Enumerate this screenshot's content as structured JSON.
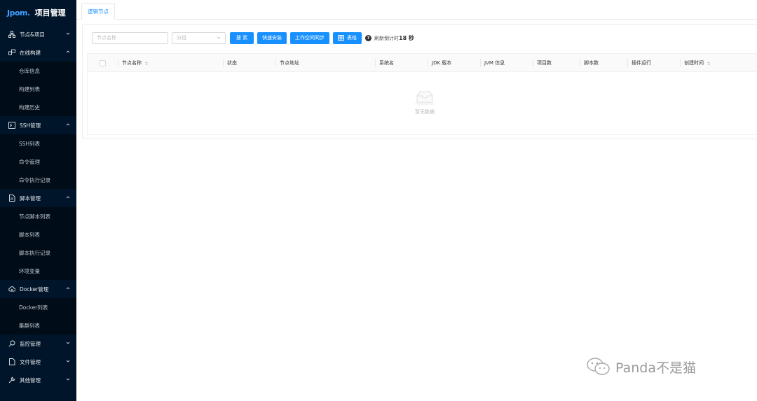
{
  "app": {
    "logo": "Jpom.",
    "title": "项目管理"
  },
  "sidebar": {
    "groups": [
      {
        "label": "节点&项目",
        "icon": "cluster-icon",
        "open": false,
        "items": []
      },
      {
        "label": "在线构建",
        "icon": "build-icon",
        "open": true,
        "items": [
          "仓库信息",
          "构建列表",
          "构建历史"
        ]
      },
      {
        "label": "SSH管理",
        "icon": "terminal-icon",
        "open": true,
        "items": [
          "SSH列表",
          "命令管理",
          "命令执行记录"
        ]
      },
      {
        "label": "脚本管理",
        "icon": "file-code-icon",
        "open": true,
        "items": [
          "节点脚本列表",
          "脚本列表",
          "脚本执行记录",
          "环境变量"
        ]
      },
      {
        "label": "Docker管理",
        "icon": "cloud-icon",
        "open": true,
        "items": [
          "Docker列表",
          "集群列表"
        ]
      },
      {
        "label": "监控管理",
        "icon": "monitor-icon",
        "open": false,
        "items": []
      },
      {
        "label": "文件管理",
        "icon": "file-icon",
        "open": false,
        "items": []
      },
      {
        "label": "其他管理",
        "icon": "tool-icon",
        "open": false,
        "items": []
      }
    ]
  },
  "tabs": [
    {
      "label": "逻辑节点",
      "active": true
    }
  ],
  "toolbar": {
    "name_placeholder": "节点名称",
    "group_placeholder": "分组",
    "search_label": "搜 索",
    "quick_install_label": "快速安装",
    "sync_label": "工作空间同步",
    "table_label": "表格",
    "countdown_prefix": "刷新倒计时",
    "countdown_value": "18 秒"
  },
  "table": {
    "columns": [
      {
        "label": "节点名称",
        "sortable": true
      },
      {
        "label": "状态",
        "sortable": false
      },
      {
        "label": "节点地址",
        "sortable": false
      },
      {
        "label": "系统名",
        "sortable": false
      },
      {
        "label": "JDK 版本",
        "sortable": false
      },
      {
        "label": "JVM 信息",
        "sortable": false
      },
      {
        "label": "项目数",
        "sortable": false
      },
      {
        "label": "脚本数",
        "sortable": false
      },
      {
        "label": "插件运行",
        "sortable": false
      },
      {
        "label": "创建时间",
        "sortable": true
      }
    ],
    "rows": [],
    "empty_text": "暂无数据"
  },
  "watermark": {
    "text": "Panda不是猫"
  }
}
